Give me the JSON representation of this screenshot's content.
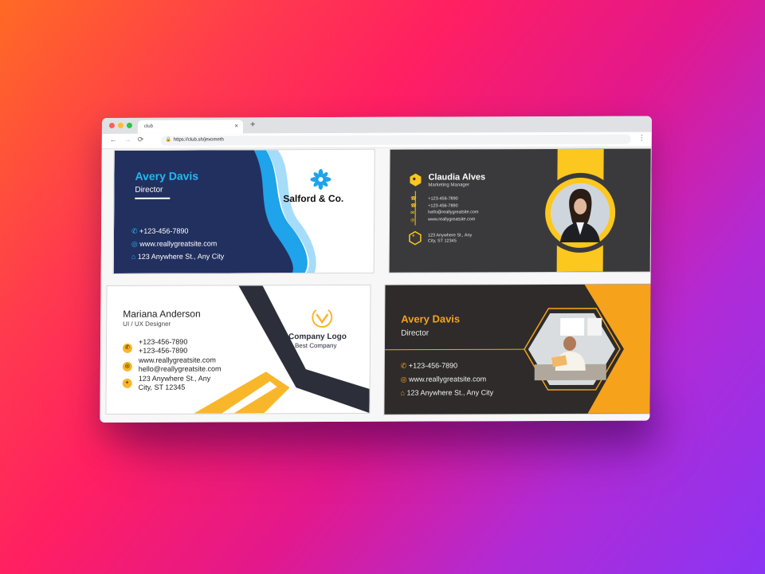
{
  "browser": {
    "tab_title": "club",
    "tab_close": "×",
    "new_tab": "+",
    "url": "https://club.sh/jexometh",
    "back_icon": "←",
    "forward_icon": "→",
    "reload_icon": "⟳",
    "menu_icon": "⋮"
  },
  "cards": {
    "card1": {
      "name": "Avery Davis",
      "title": "Director",
      "phone": "+123-456-7890",
      "website": "www.reallygreatsite.com",
      "address": "123 Anywhere St., Any City",
      "company": "Salford & Co.",
      "colors": {
        "navy": "#22305f",
        "accent": "#1fa3ea"
      }
    },
    "card2": {
      "name": "Claudia Alves",
      "title": "Marketing Manager",
      "phone1": "+123-456-7890",
      "phone2": "+123-456-7890",
      "email": "hello@reallygreatsite.com",
      "website": "www.reallygreatsite.com",
      "address_line1": "123 Anywhere St., Any",
      "address_line2": "City, ST 12345",
      "colors": {
        "dark": "#3a3a3c",
        "accent": "#fcc71e"
      }
    },
    "card3": {
      "name": "Mariana Anderson",
      "title": "UI / UX Designer",
      "phone1": "+123-456-7890",
      "phone2": "+123-456-7890",
      "website": "www.reallygreatsite.com",
      "email": "hello@reallygreatsite.com",
      "address_line1": "123 Anywhere St., Any",
      "address_line2": "City, ST 12345",
      "logo_title": "Company Logo",
      "logo_subtitle": "Best Company",
      "colors": {
        "dark": "#2c2f3a",
        "accent": "#f8b72b"
      }
    },
    "card4": {
      "name": "Avery Davis",
      "title": "Director",
      "phone": "+123-456-7890",
      "website": "www.reallygreatsite.com",
      "address": "123 Anywhere St., Any City",
      "colors": {
        "dark": "#2e2b2a",
        "accent": "#f7a21b"
      }
    }
  }
}
